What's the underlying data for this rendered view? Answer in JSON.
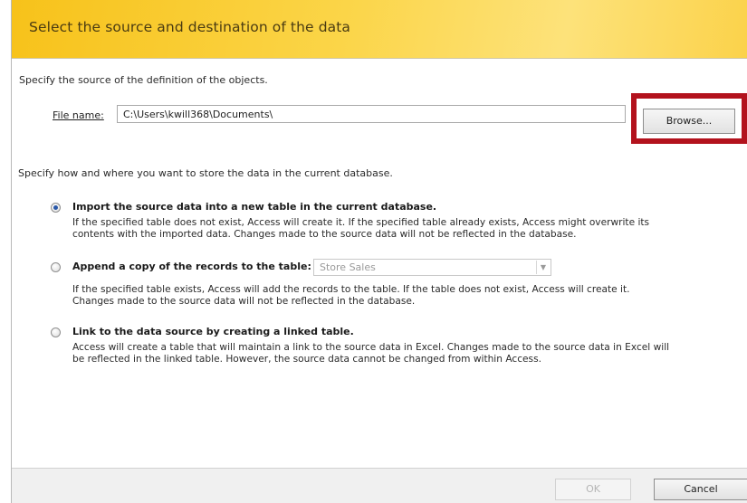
{
  "header": {
    "title": "Select the source and destination of the data"
  },
  "source": {
    "instruction": "Specify the source of the definition of the objects.",
    "file_label": "File name:",
    "file_value": "C:\\Users\\kwill368\\Documents\\",
    "browse_label": "Browse..."
  },
  "storage": {
    "instruction": "Specify how and where you want to store the data in the current database.",
    "options": [
      {
        "label": "Import the source data into a new table in the current database.",
        "selected": true,
        "desc_line1": "If the specified table does not exist, Access will create it. If the specified table already exists, Access might overwrite its",
        "desc_line2": "contents with the imported data. Changes made to the source data will not be reflected in the database."
      },
      {
        "label": "Append a copy of the records to the table:",
        "selected": false,
        "table_value": "Store Sales",
        "desc_line1": "If the specified table exists, Access will add the records to the table. If the table does not exist, Access will create it.",
        "desc_line2": "Changes made to the source data will not be reflected in the database."
      },
      {
        "label": "Link to the data source by creating a linked table.",
        "selected": false,
        "desc_line1": "Access will create a table that will maintain a link to the source data in Excel. Changes made to the source data in Excel will",
        "desc_line2": "be reflected in the linked table. However, the source data cannot be changed from within Access."
      }
    ]
  },
  "footer": {
    "ok_label": "OK",
    "cancel_label": "Cancel"
  },
  "colors": {
    "header_accent": "#fbd548",
    "highlight_box": "#b3121d",
    "radio_selected": "#2a58a8"
  }
}
